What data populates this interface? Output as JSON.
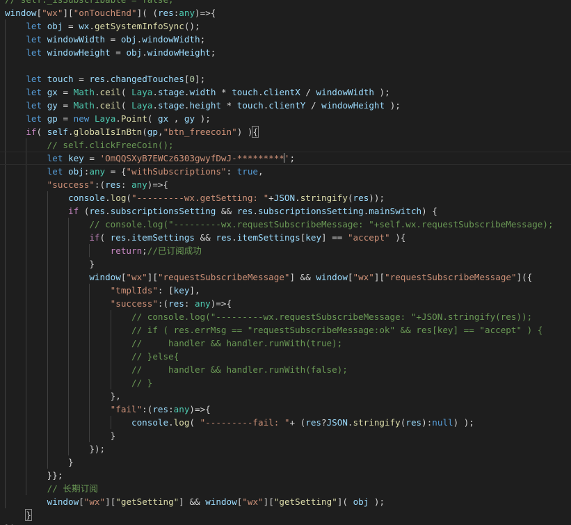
{
  "theme": {
    "background": "#1e1e1e",
    "text": "#d4d4d4",
    "keyword": "#569cd6",
    "control": "#c586c0",
    "string": "#ce9178",
    "variable": "#9cdcfe",
    "function": "#dcdcaa",
    "type": "#4ec9b0",
    "number": "#b5cea8",
    "comment": "#6a9955"
  },
  "editor": {
    "lines": [
      [
        [
          "c",
          "// self._isSubscribable = false;"
        ]
      ],
      [
        [
          "v",
          "window"
        ],
        [
          "p",
          "["
        ],
        [
          "s",
          "\"wx\""
        ],
        [
          "p",
          "]["
        ],
        [
          "s",
          "\"onTouchEnd\""
        ],
        [
          "p",
          "]( ("
        ],
        [
          "v",
          "res"
        ],
        [
          "p",
          ":"
        ],
        [
          "t",
          "any"
        ],
        [
          "p",
          ")=>{"
        ]
      ],
      [
        [
          "p",
          "    "
        ],
        [
          "k",
          "let"
        ],
        [
          "p",
          " "
        ],
        [
          "v",
          "obj"
        ],
        [
          "p",
          " = "
        ],
        [
          "v",
          "wx"
        ],
        [
          "p",
          "."
        ],
        [
          "f",
          "getSystemInfoSync"
        ],
        [
          "p",
          "();"
        ]
      ],
      [
        [
          "p",
          "    "
        ],
        [
          "k",
          "let"
        ],
        [
          "p",
          " "
        ],
        [
          "v",
          "windowWidth"
        ],
        [
          "p",
          " = "
        ],
        [
          "v",
          "obj"
        ],
        [
          "p",
          "."
        ],
        [
          "v",
          "windowWidth"
        ],
        [
          "p",
          ";"
        ]
      ],
      [
        [
          "p",
          "    "
        ],
        [
          "k",
          "let"
        ],
        [
          "p",
          " "
        ],
        [
          "v",
          "windowHeight"
        ],
        [
          "p",
          " = "
        ],
        [
          "v",
          "obj"
        ],
        [
          "p",
          "."
        ],
        [
          "v",
          "windowHeight"
        ],
        [
          "p",
          ";"
        ]
      ],
      [],
      [
        [
          "p",
          "    "
        ],
        [
          "k",
          "let"
        ],
        [
          "p",
          " "
        ],
        [
          "v",
          "touch"
        ],
        [
          "p",
          " = "
        ],
        [
          "v",
          "res"
        ],
        [
          "p",
          "."
        ],
        [
          "v",
          "changedTouches"
        ],
        [
          "p",
          "["
        ],
        [
          "n",
          "0"
        ],
        [
          "p",
          "];"
        ]
      ],
      [
        [
          "p",
          "    "
        ],
        [
          "k",
          "let"
        ],
        [
          "p",
          " "
        ],
        [
          "v",
          "gx"
        ],
        [
          "p",
          " = "
        ],
        [
          "t",
          "Math"
        ],
        [
          "p",
          "."
        ],
        [
          "f",
          "ceil"
        ],
        [
          "p",
          "( "
        ],
        [
          "t",
          "Laya"
        ],
        [
          "p",
          "."
        ],
        [
          "v",
          "stage"
        ],
        [
          "p",
          "."
        ],
        [
          "v",
          "width"
        ],
        [
          "p",
          " * "
        ],
        [
          "v",
          "touch"
        ],
        [
          "p",
          "."
        ],
        [
          "v",
          "clientX"
        ],
        [
          "p",
          " / "
        ],
        [
          "v",
          "windowWidth"
        ],
        [
          "p",
          " );"
        ]
      ],
      [
        [
          "p",
          "    "
        ],
        [
          "k",
          "let"
        ],
        [
          "p",
          " "
        ],
        [
          "v",
          "gy"
        ],
        [
          "p",
          " = "
        ],
        [
          "t",
          "Math"
        ],
        [
          "p",
          "."
        ],
        [
          "f",
          "ceil"
        ],
        [
          "p",
          "( "
        ],
        [
          "t",
          "Laya"
        ],
        [
          "p",
          "."
        ],
        [
          "v",
          "stage"
        ],
        [
          "p",
          "."
        ],
        [
          "v",
          "height"
        ],
        [
          "p",
          " * "
        ],
        [
          "v",
          "touch"
        ],
        [
          "p",
          "."
        ],
        [
          "v",
          "clientY"
        ],
        [
          "p",
          " / "
        ],
        [
          "v",
          "windowHeight"
        ],
        [
          "p",
          " );"
        ]
      ],
      [
        [
          "p",
          "    "
        ],
        [
          "k",
          "let"
        ],
        [
          "p",
          " "
        ],
        [
          "v",
          "gp"
        ],
        [
          "p",
          " = "
        ],
        [
          "k",
          "new"
        ],
        [
          "p",
          " "
        ],
        [
          "t",
          "Laya"
        ],
        [
          "p",
          "."
        ],
        [
          "f",
          "Point"
        ],
        [
          "p",
          "( "
        ],
        [
          "v",
          "gx"
        ],
        [
          "p",
          " , "
        ],
        [
          "v",
          "gy"
        ],
        [
          "p",
          " );"
        ]
      ],
      [
        [
          "p",
          "    "
        ],
        [
          "x",
          "if"
        ],
        [
          "p",
          "( "
        ],
        [
          "v",
          "self"
        ],
        [
          "p",
          "."
        ],
        [
          "f",
          "globalIsInBtn"
        ],
        [
          "p",
          "("
        ],
        [
          "v",
          "gp"
        ],
        [
          "p",
          ","
        ],
        [
          "s",
          "\"btn_freecoin\""
        ],
        [
          "p",
          ") )"
        ],
        [
          "b",
          "{"
        ]
      ],
      [
        [
          "p",
          "        "
        ],
        [
          "c",
          "// self.clickFreeCoin();"
        ]
      ],
      [
        [
          "p",
          "        "
        ],
        [
          "k",
          "let"
        ],
        [
          "p",
          " "
        ],
        [
          "v",
          "key"
        ],
        [
          "p",
          " = "
        ],
        [
          "s",
          "'OmQQSXyB7EWCz6303gwyfDwJ-*********"
        ],
        [
          "cursor",
          ""
        ],
        [
          "s",
          "'"
        ],
        [
          "p",
          ";"
        ]
      ],
      [
        [
          "p",
          "        "
        ],
        [
          "k",
          "let"
        ],
        [
          "p",
          " "
        ],
        [
          "v",
          "obj"
        ],
        [
          "p",
          ":"
        ],
        [
          "t",
          "any"
        ],
        [
          "p",
          " = {"
        ],
        [
          "s",
          "\"withSubscriptions\""
        ],
        [
          "p",
          ": "
        ],
        [
          "k",
          "true"
        ],
        [
          "p",
          ","
        ]
      ],
      [
        [
          "p",
          "        "
        ],
        [
          "s",
          "\"success\""
        ],
        [
          "p",
          ":("
        ],
        [
          "v",
          "res"
        ],
        [
          "p",
          ": "
        ],
        [
          "t",
          "any"
        ],
        [
          "p",
          ")=>{"
        ]
      ],
      [
        [
          "p",
          "            "
        ],
        [
          "v",
          "console"
        ],
        [
          "p",
          "."
        ],
        [
          "f",
          "log"
        ],
        [
          "p",
          "("
        ],
        [
          "s",
          "\"---------wx.getSetting: \""
        ],
        [
          "p",
          "+"
        ],
        [
          "v",
          "JSON"
        ],
        [
          "p",
          "."
        ],
        [
          "f",
          "stringify"
        ],
        [
          "p",
          "("
        ],
        [
          "v",
          "res"
        ],
        [
          "p",
          "));"
        ]
      ],
      [
        [
          "p",
          "            "
        ],
        [
          "x",
          "if"
        ],
        [
          "p",
          " ("
        ],
        [
          "v",
          "res"
        ],
        [
          "p",
          "."
        ],
        [
          "v",
          "subscriptionsSetting"
        ],
        [
          "p",
          " && "
        ],
        [
          "v",
          "res"
        ],
        [
          "p",
          "."
        ],
        [
          "v",
          "subscriptionsSetting"
        ],
        [
          "p",
          "."
        ],
        [
          "v",
          "mainSwitch"
        ],
        [
          "p",
          ") {"
        ]
      ],
      [
        [
          "p",
          "                "
        ],
        [
          "c",
          "// console.log(\"---------wx.requestSubscribeMessage: \"+self.wx.requestSubscribeMessage);"
        ]
      ],
      [
        [
          "p",
          "                "
        ],
        [
          "x",
          "if"
        ],
        [
          "p",
          "( "
        ],
        [
          "v",
          "res"
        ],
        [
          "p",
          "."
        ],
        [
          "v",
          "itemSettings"
        ],
        [
          "p",
          " && "
        ],
        [
          "v",
          "res"
        ],
        [
          "p",
          "."
        ],
        [
          "v",
          "itemSettings"
        ],
        [
          "p",
          "["
        ],
        [
          "v",
          "key"
        ],
        [
          "p",
          "] == "
        ],
        [
          "s",
          "\"accept\""
        ],
        [
          "p",
          " ){"
        ]
      ],
      [
        [
          "p",
          "                    "
        ],
        [
          "x",
          "return"
        ],
        [
          "p",
          ";"
        ],
        [
          "c",
          "//已订阅成功"
        ]
      ],
      [
        [
          "p",
          "                }"
        ]
      ],
      [
        [
          "p",
          "                "
        ],
        [
          "v",
          "window"
        ],
        [
          "p",
          "["
        ],
        [
          "s",
          "\"wx\""
        ],
        [
          "p",
          "]["
        ],
        [
          "s",
          "\"requestSubscribeMessage\""
        ],
        [
          "p",
          "] && "
        ],
        [
          "v",
          "window"
        ],
        [
          "p",
          "["
        ],
        [
          "s",
          "\"wx\""
        ],
        [
          "p",
          "]["
        ],
        [
          "s",
          "\"requestSubscribeMessage\""
        ],
        [
          "p",
          "]({"
        ]
      ],
      [
        [
          "p",
          "                    "
        ],
        [
          "s",
          "\"tmplIds\""
        ],
        [
          "p",
          ": ["
        ],
        [
          "v",
          "key"
        ],
        [
          "p",
          "],"
        ]
      ],
      [
        [
          "p",
          "                    "
        ],
        [
          "s",
          "\"success\""
        ],
        [
          "p",
          ":("
        ],
        [
          "v",
          "res"
        ],
        [
          "p",
          ": "
        ],
        [
          "t",
          "any"
        ],
        [
          "p",
          ")=>{"
        ]
      ],
      [
        [
          "p",
          "                        "
        ],
        [
          "c",
          "// console.log(\"---------wx.requestSubscribeMessage: \"+JSON.stringify(res));"
        ]
      ],
      [
        [
          "p",
          "                        "
        ],
        [
          "c",
          "// if ( res.errMsg == \"requestSubscribeMessage:ok\" && res[key] == \"accept\" ) {"
        ]
      ],
      [
        [
          "p",
          "                        "
        ],
        [
          "c",
          "//     handler && handler.runWith(true);"
        ]
      ],
      [
        [
          "p",
          "                        "
        ],
        [
          "c",
          "// }else{"
        ]
      ],
      [
        [
          "p",
          "                        "
        ],
        [
          "c",
          "//     handler && handler.runWith(false);"
        ]
      ],
      [
        [
          "p",
          "                        "
        ],
        [
          "c",
          "// }"
        ]
      ],
      [
        [
          "p",
          "                    },"
        ]
      ],
      [
        [
          "p",
          "                    "
        ],
        [
          "s",
          "\"fail\""
        ],
        [
          "p",
          ":("
        ],
        [
          "v",
          "res"
        ],
        [
          "p",
          ":"
        ],
        [
          "t",
          "any"
        ],
        [
          "p",
          ")=>{"
        ]
      ],
      [
        [
          "p",
          "                        "
        ],
        [
          "v",
          "console"
        ],
        [
          "p",
          "."
        ],
        [
          "f",
          "log"
        ],
        [
          "p",
          "( "
        ],
        [
          "s",
          "\"---------fail: \""
        ],
        [
          "p",
          "+ ("
        ],
        [
          "v",
          "res"
        ],
        [
          "p",
          "?"
        ],
        [
          "v",
          "JSON"
        ],
        [
          "p",
          "."
        ],
        [
          "f",
          "stringify"
        ],
        [
          "p",
          "("
        ],
        [
          "v",
          "res"
        ],
        [
          "p",
          "):"
        ],
        [
          "k",
          "null"
        ],
        [
          "p",
          ") );"
        ]
      ],
      [
        [
          "p",
          "                    }"
        ]
      ],
      [
        [
          "p",
          "                });"
        ]
      ],
      [
        [
          "p",
          "            }"
        ]
      ],
      [
        [
          "p",
          "        }};"
        ]
      ],
      [
        [
          "p",
          "        "
        ],
        [
          "c",
          "// 长期订阅"
        ]
      ],
      [
        [
          "p",
          "        "
        ],
        [
          "v",
          "window"
        ],
        [
          "p",
          "["
        ],
        [
          "s",
          "\"wx\""
        ],
        [
          "p",
          "]["
        ],
        [
          "f",
          "\"getSetting\""
        ],
        [
          "p",
          "] && "
        ],
        [
          "v",
          "window"
        ],
        [
          "p",
          "["
        ],
        [
          "s",
          "\"wx\""
        ],
        [
          "p",
          "]["
        ],
        [
          "f",
          "\"getSetting\""
        ],
        [
          "p",
          "]( "
        ],
        [
          "v",
          "obj"
        ],
        [
          "p",
          " );"
        ]
      ],
      [
        [
          "p",
          "    "
        ],
        [
          "b",
          "}"
        ]
      ],
      [
        [
          "p",
          "});"
        ]
      ]
    ]
  }
}
